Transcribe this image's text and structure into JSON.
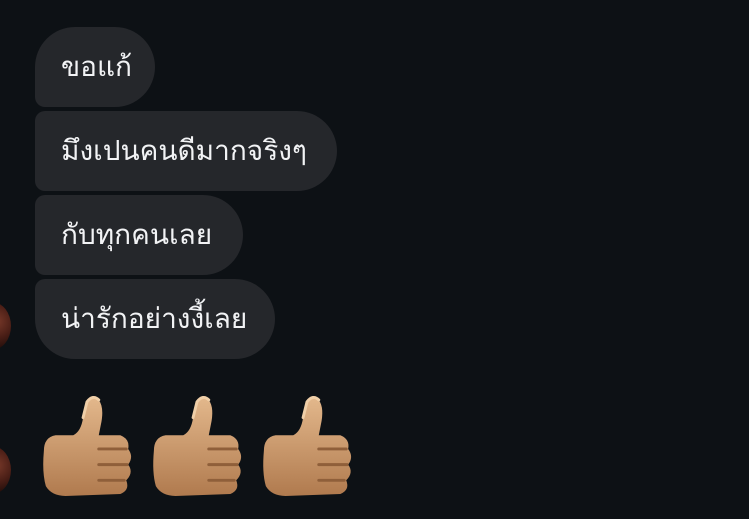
{
  "messages": [
    {
      "text": "ขอแก้"
    },
    {
      "text": "มึงเปนคนดีมากจริงๆ"
    },
    {
      "text": "กับทุกคนเลย"
    },
    {
      "text": "น่ารักอย่างงี้เลย"
    }
  ],
  "reaction": {
    "icon": "thumbs-up-icon",
    "count": 3
  },
  "colors": {
    "background": "#0d1115",
    "bubble": "#25272b",
    "text": "#f2f3f5",
    "skin": "#d9a877"
  }
}
